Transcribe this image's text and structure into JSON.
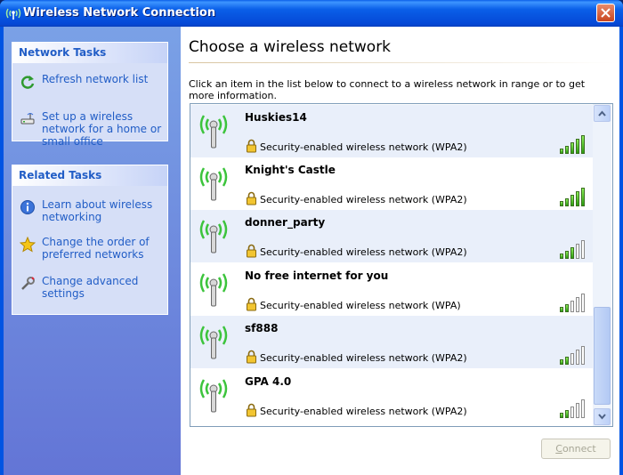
{
  "window": {
    "title": "Wireless Network Connection",
    "close_icon": "close-icon"
  },
  "left": {
    "network_tasks": {
      "title": "Network Tasks",
      "items": [
        {
          "label": "Refresh network list",
          "icon": "refresh-icon"
        },
        {
          "label": "Set up a wireless network for a home or small office",
          "icon": "setup-network-icon"
        }
      ]
    },
    "related_tasks": {
      "title": "Related Tasks",
      "items": [
        {
          "label": "Learn about wireless networking",
          "icon": "info-icon"
        },
        {
          "label": "Change the order of preferred networks",
          "icon": "star-icon"
        },
        {
          "label": "Change advanced settings",
          "icon": "settings-icon"
        }
      ]
    }
  },
  "main": {
    "heading": "Choose a wireless network",
    "instructions": "Click an item in the list below to connect to a wireless network in range or to get more information.",
    "networks": [
      {
        "name": "Huskies14",
        "security": "Security-enabled wireless network (WPA2)",
        "signal_bars": 4
      },
      {
        "name": "Knight's Castle",
        "security": "Security-enabled wireless network (WPA2)",
        "signal_bars": 4
      },
      {
        "name": "donner_party",
        "security": "Security-enabled wireless network (WPA2)",
        "signal_bars": 2
      },
      {
        "name": "No free internet for you",
        "security": "Security-enabled wireless network (WPA)",
        "signal_bars": 1
      },
      {
        "name": "sf888",
        "security": "Security-enabled wireless network (WPA2)",
        "signal_bars": 1
      },
      {
        "name": "GPA 4.0",
        "security": "Security-enabled wireless network (WPA2)",
        "signal_bars": 1
      }
    ],
    "connect_label_first": "C",
    "connect_label_rest": "onnect",
    "connect_enabled": false
  },
  "colors": {
    "link": "#215dc6",
    "titlebar": "#0054e3",
    "signal_green": "#2c9e10"
  }
}
